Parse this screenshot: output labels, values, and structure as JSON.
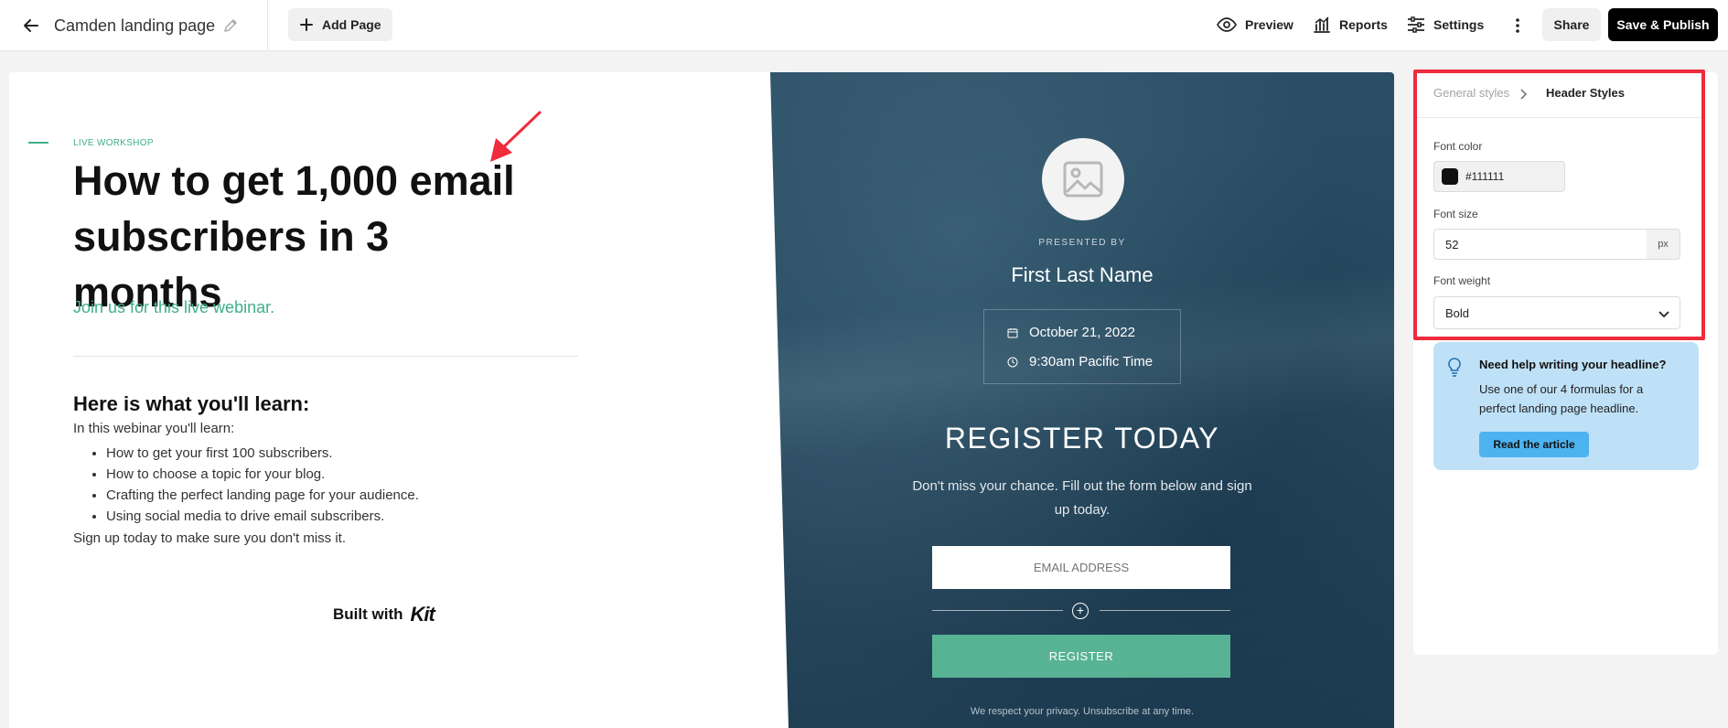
{
  "topbar": {
    "page_name": "Camden landing page",
    "add_page_label": "Add Page",
    "preview_label": "Preview",
    "reports_label": "Reports",
    "settings_label": "Settings",
    "share_label": "Share",
    "publish_label": "Save & Publish"
  },
  "page": {
    "eyebrow": "LIVE WORKSHOP",
    "headline": "How to get 1,000 email subscribers in 3 months",
    "subhead": "Join us for this live webinar.",
    "learn_title": "Here is what you'll learn:",
    "learn_intro": "In this webinar you'll learn:",
    "learn_items": [
      "How to get your first 100 subscribers.",
      "How to choose a topic for your blog.",
      "Crafting the perfect landing page for your audience.",
      "Using social media to drive email subscribers."
    ],
    "learn_outro": "Sign up today to make sure you don't miss it.",
    "built_with": "Built with",
    "kit_logo": "Kit"
  },
  "hero": {
    "presented_by": "PRESENTED BY",
    "presenter": "First Last Name",
    "date": "October 21, 2022",
    "time": "9:30am Pacific Time",
    "register_title": "REGISTER TODAY",
    "register_desc": "Don't miss your chance. Fill out the form below and sign up today.",
    "email_placeholder": "EMAIL ADDRESS",
    "register_button": "REGISTER",
    "privacy": "We respect your privacy. Unsubscribe at any time."
  },
  "sidebar": {
    "breadcrumb_parent": "General styles",
    "breadcrumb_current": "Header Styles",
    "font_color_label": "Font color",
    "font_color_value": "#111111",
    "font_size_label": "Font size",
    "font_size_value": "52",
    "font_size_unit": "px",
    "font_weight_label": "Font weight",
    "font_weight_value": "Bold",
    "help_title": "Need help writing your headline?",
    "help_text": "Use one of our 4 formulas for a perfect landing page headline.",
    "help_button": "Read the article"
  },
  "colors": {
    "accent": "#3fae8b",
    "register_button": "#57b394",
    "highlight": "#ef2b3c",
    "help_card": "#bfe1f7",
    "help_button": "#4db3f0"
  }
}
